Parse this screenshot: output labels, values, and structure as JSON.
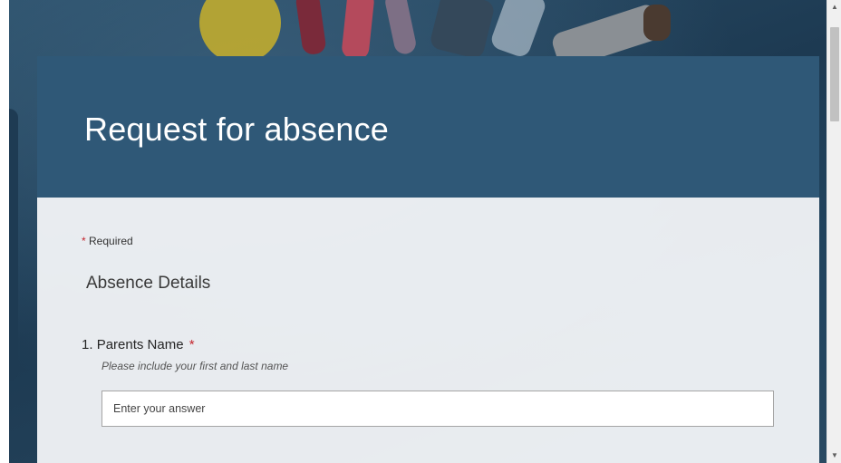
{
  "form": {
    "title": "Request for absence",
    "required_label": "Required",
    "required_marker": "*",
    "section_title": "Absence Details",
    "questions": [
      {
        "number": "1.",
        "label": "Parents Name",
        "required_marker": "*",
        "hint": "Please include your first and last name",
        "placeholder": "Enter your answer"
      }
    ]
  },
  "theme": {
    "header_color": "#2f5877",
    "required_color": "#c4262e"
  },
  "scrollbar": {
    "up_icon": "arrow-up-icon",
    "down_icon": "arrow-down-icon"
  }
}
